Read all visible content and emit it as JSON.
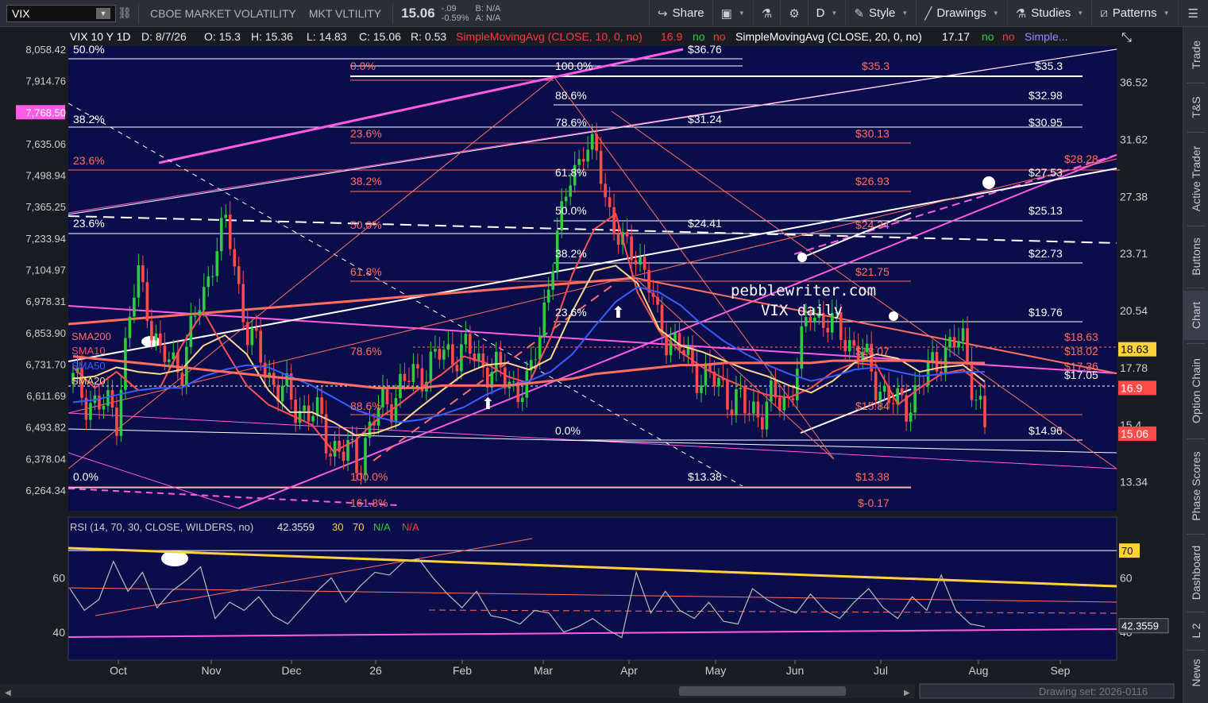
{
  "toolbar": {
    "symbol": "VIX",
    "description": "CBOE MARKET VOLATILITY",
    "short_name": "MKT VLTILITY",
    "last": "15.06",
    "change": "-.09",
    "change_pct": "-0.59%",
    "bid": "B: N/A",
    "ask": "A: N/A",
    "share": "Share",
    "timeframe": "D",
    "style": "Style",
    "drawings": "Drawings",
    "studies": "Studies",
    "patterns": "Patterns"
  },
  "sidebar": [
    "Trade",
    "T&S",
    "Active Trader",
    "Buttons",
    "Chart",
    "Option Chain",
    "Phase Scores",
    "Dashboard",
    "L 2",
    "News"
  ],
  "header": {
    "title": "VIX 10 Y 1D",
    "date": "D: 8/7/26",
    "open": "O: 15.3",
    "high": "H: 15.36",
    "low": "L: 14.83",
    "close": "C: 15.06",
    "range": "R: 0.53",
    "sma10_label": "SimpleMovingAvg (CLOSE, 10, 0, no)",
    "sma10_value": "16.9",
    "sma20_label": "SimpleMovingAvg (CLOSE, 20, 0, no)",
    "sma20_value": "17.17",
    "flag_no": "no",
    "more": "Simple..."
  },
  "rsi_header": {
    "label": "RSI (14, 70, 30, CLOSE, WILDERS, no)",
    "value": "42.3559",
    "ob": "30",
    "os": "70",
    "na1": "N/A",
    "na2": "N/A"
  },
  "watermark": {
    "line1": "pebblewriter.com",
    "line2": "VIX daily"
  },
  "footer": {
    "drawing_set": "Drawing set: 2026-0116"
  },
  "colors": {
    "bg": "#0b0d4a",
    "pink": "#ff5ce6",
    "salmon": "#ff6f61",
    "white": "#ffffff",
    "yellow": "#ffd23a",
    "blue": "#3a5cff",
    "up": "#2ecc40",
    "down": "#ff4a4a"
  },
  "chart_data": [
    {
      "type": "line",
      "title": "VIX 10 Y 1D",
      "x_labels": [
        "Oct",
        "Nov",
        "Dec",
        "26",
        "Feb",
        "Mar",
        "Apr",
        "May",
        "Jun",
        "Jul",
        "Aug",
        "Sep"
      ],
      "right_axis_ticks": [
        36.52,
        31.62,
        27.38,
        23.71,
        20.54,
        17.78,
        15.4,
        13.34
      ],
      "left_axis_ticks": [
        8058.42,
        7914.76,
        7768.5,
        7635.06,
        7498.94,
        7365.25,
        7233.94,
        7104.97,
        6978.31,
        6853.9,
        6731.7,
        6611.69,
        6493.82,
        6378.04,
        6264.34
      ],
      "left_axis_highlight": 7768.5,
      "y_scale": "log",
      "ylim": [
        12.4,
        40
      ],
      "series": [
        {
          "name": "SMA10",
          "color": "#ff5050",
          "values": [
            17.8,
            16.9,
            17.6,
            16.8,
            16.9,
            18.8,
            20.5,
            18.6,
            17.0,
            16.2,
            15.8,
            15.4,
            14.4,
            14.8,
            15.6,
            16.2,
            16.9,
            17.5,
            18.3,
            18.0,
            17.4,
            17.1,
            19.2,
            22.5,
            25.2,
            26.2,
            21.5,
            19.5,
            18.5,
            17.8,
            17.3,
            16.9,
            16.6,
            16.5,
            16.9,
            17.6,
            18.0,
            17.9,
            16.2,
            16.9,
            17.5,
            17.7,
            16.9
          ]
        },
        {
          "name": "SMA20",
          "color": "#ffd88a",
          "values": [
            17.3,
            17.4,
            17.8,
            17.6,
            17.5,
            17.7,
            18.8,
            19.3,
            18.4,
            16.8,
            15.9,
            15.9,
            15.5,
            15.0,
            15.1,
            15.4,
            16.1,
            16.8,
            17.5,
            17.9,
            18.0,
            17.7,
            18.2,
            20.5,
            22.7,
            23.0,
            22.0,
            19.6,
            18.8,
            18.5,
            18.1,
            17.7,
            17.4,
            17.0,
            16.7,
            17.2,
            18.0,
            18.4,
            18.2,
            17.6,
            17.8,
            17.9,
            17.17
          ]
        },
        {
          "name": "SMA50",
          "color": "#3a5cff",
          "values": [
            16.3,
            16.4,
            16.6,
            16.8,
            16.9,
            16.9,
            17.4,
            17.7,
            17.9,
            17.8,
            17.4,
            17.0,
            16.5,
            16.0,
            15.7,
            15.5,
            15.6,
            15.8,
            16.1,
            16.6,
            17.0,
            17.2,
            17.6,
            18.4,
            19.7,
            21.0,
            21.8,
            21.5,
            20.8,
            19.8,
            19.0,
            18.4,
            17.9,
            17.5,
            17.2,
            17.4,
            17.7,
            17.8,
            17.6,
            17.4,
            17.5,
            17.6,
            17.6
          ]
        },
        {
          "name": "SMA200",
          "color": "#ff6f61",
          "values": [
            18.3,
            18.2,
            18.1,
            18.0,
            17.9,
            17.8,
            17.7,
            17.6,
            17.5,
            17.4,
            17.3,
            17.2,
            17.1,
            17.0,
            16.9,
            16.9,
            16.9,
            17.0,
            17.0,
            17.0,
            17.0,
            17.1,
            17.2,
            17.3,
            17.5,
            17.6,
            17.7,
            17.8,
            17.9,
            17.9,
            18.0,
            18.0,
            18.0,
            18.0,
            18.0,
            18.1,
            18.1,
            18.1,
            18.1,
            18.1,
            18.0,
            18.0,
            18.0
          ]
        }
      ],
      "close_series": [
        17.1,
        16.2,
        15.9,
        22.6,
        18.2,
        17.9,
        21.4,
        25.8,
        19.5,
        17.5,
        16.3,
        15.9,
        14.6,
        14.0,
        15.8,
        16.9,
        17.6,
        18.4,
        18.6,
        17.9,
        17.2,
        16.8,
        22.5,
        29.5,
        31.2,
        24.5,
        23.8,
        19.8,
        18.5,
        17.4,
        16.9,
        15.9,
        16.2,
        16.5,
        20.6,
        19.7,
        18.8,
        17.2,
        16.0,
        16.9,
        18.5,
        19.0,
        15.06
      ],
      "tick_prices": [
        36.76,
        35.3,
        32.98,
        31.24,
        30.95,
        30.13,
        28.28,
        27.53,
        26.93,
        25.13,
        24.41,
        24.34,
        22.73,
        21.75,
        19.76,
        18.63,
        18.02,
        17.36,
        17.05,
        16.9,
        15.06,
        14.96,
        13.38,
        -0.17
      ],
      "fib_labels": [
        "0.0%",
        "100.0%",
        "88.6%",
        "78.6%",
        "61.8%",
        "50.0%",
        "38.2%",
        "23.6%",
        "0.0%",
        "23.6%",
        "38.2%",
        "50.0%",
        "61.8%",
        "78.6%",
        "88.6%",
        "100.0%",
        "161.8%",
        "50.0%",
        "38.2%",
        "23.6%",
        "0.0%"
      ],
      "price_labels": {
        "36.76": "$36.76",
        "35.3": "$35.3",
        "32.98": "$32.98",
        "31.24": "$31.24",
        "30.95": "$30.95",
        "30.13": "$30.13",
        "28.28": "$28.28",
        "27.53": "$27.53",
        "26.93": "$26.93",
        "25.13": "$25.13",
        "24.41": "$24.41",
        "24.34": "$24.34",
        "22.73": "$22.73",
        "21.75": "$21.75",
        "19.76": "$19.76",
        "18.63": "$18.63",
        "18.02": "$18.02",
        "17.36": "$17.36",
        "17.05": "$17.05",
        "14.96": "$14.96",
        "13.38": "$13.38",
        "neg": "$-0.17",
        "15.84": "$15.84",
        "18.07": "$18.07"
      },
      "right_badges": [
        {
          "value": "18.63",
          "color": "#ffd23a"
        },
        {
          "value": "16.9",
          "color": "#ff4a4a"
        },
        {
          "value": "15.06",
          "color": "#ff4a4a"
        }
      ],
      "sma_tags": [
        "SMA200",
        "SMA10",
        "SMA50",
        "SMA20"
      ]
    },
    {
      "type": "line",
      "title": "RSI (14, 70, 30, CLOSE, WILDERS, no)",
      "y_ticks": [
        70,
        60,
        40
      ],
      "ylim": [
        30,
        75
      ],
      "current": 42.3559,
      "series": [
        {
          "name": "RSI",
          "color": "#bbbbbb",
          "values": [
            56,
            48,
            52,
            66,
            55,
            62,
            49,
            55,
            59,
            64,
            45,
            51,
            48,
            53,
            46,
            43,
            49,
            55,
            60,
            51,
            57,
            62,
            61,
            66,
            67,
            60,
            54,
            49,
            55,
            46,
            45,
            43,
            48,
            47,
            40,
            42,
            45,
            41,
            38,
            62,
            47,
            55,
            48,
            45,
            51,
            44,
            43,
            56,
            52,
            49,
            47,
            54,
            48,
            45,
            51,
            56,
            49,
            45,
            53,
            48,
            61,
            48,
            43,
            42
          ]
        }
      ]
    }
  ]
}
